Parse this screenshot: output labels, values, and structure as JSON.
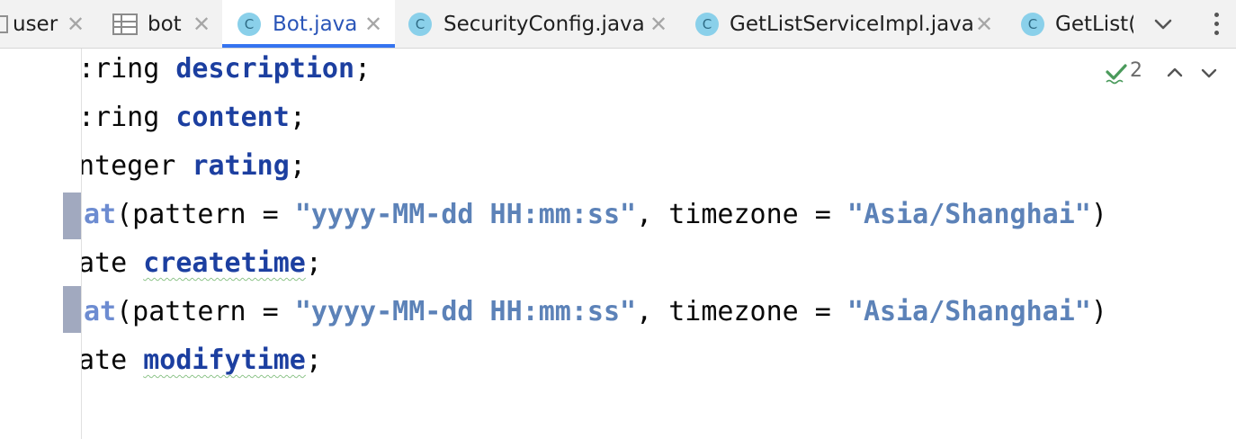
{
  "tabs": [
    {
      "label": "user",
      "kind": "file",
      "active": false,
      "closable": true
    },
    {
      "label": "bot",
      "kind": "table",
      "active": false,
      "closable": true
    },
    {
      "label": "Bot.java",
      "kind": "class",
      "active": true,
      "closable": true
    },
    {
      "label": "SecurityConfig.java",
      "kind": "class",
      "active": false,
      "closable": true
    },
    {
      "label": "GetListServiceImpl.java",
      "kind": "class",
      "active": false,
      "closable": true
    },
    {
      "label": "GetList(",
      "kind": "class",
      "active": false,
      "closable": false
    }
  ],
  "icons": {
    "class_letter": "C",
    "close_glyph": "✕",
    "more": "more-vertical-icon",
    "tabs_dropdown": "chevron-down-icon"
  },
  "inspection": {
    "count": "2"
  },
  "code_lines": [
    {
      "prefix": ":ring ",
      "name": "description",
      "suffix": ";"
    },
    {
      "prefix": ":ring ",
      "name": "content",
      "suffix": ";"
    },
    {
      "prefix": "nteger ",
      "name": "rating",
      "suffix": ";"
    },
    {
      "anno": "at",
      "open": "(pattern = ",
      "s1": "\"yyyy-MM-dd HH:mm:ss\"",
      "mid": ", timezone = ",
      "s2": "\"Asia/Shanghai\"",
      "close": ")"
    },
    {
      "prefix": "ate ",
      "name": "createtime",
      "suffix": ";"
    },
    {
      "anno": "at",
      "open": "(pattern = ",
      "s1": "\"yyyy-MM-dd HH:mm:ss\"",
      "mid": ", timezone = ",
      "s2": "\"Asia/Shanghai\"",
      "close": ")"
    },
    {
      "prefix": "ate ",
      "name": "modifytime",
      "suffix": ";"
    }
  ],
  "colors": {
    "field": "#1c3fa0",
    "annotation": "#6d8cd1",
    "string": "#5c82b8",
    "accent": "#3574f0",
    "class_icon": "#8ad0ea"
  }
}
